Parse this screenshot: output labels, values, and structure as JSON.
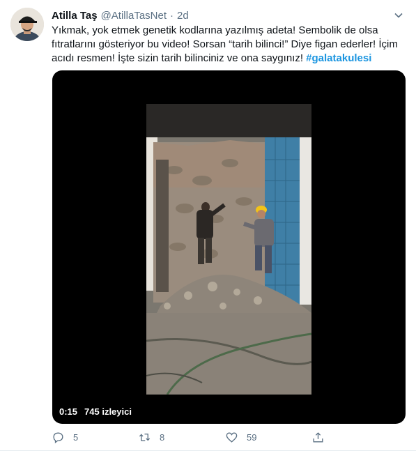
{
  "tweet": {
    "author_name": "Atilla Taş",
    "handle": "@AtillaTasNet",
    "separator": "·",
    "time": "2d",
    "text": "Yıkmak, yok etmek genetik kodlarına yazılmış adeta! Sembolik de olsa fıtratlarını gösteriyor bu video! Sorsan “tarih bilinci!” Diye figan ederler! İçim acıdı resmen! İşte sizin tarih bilinciniz ve ona saygınız!",
    "hashtag": "#galatakulesi"
  },
  "video": {
    "duration": "0:15",
    "views": "745 izleyici"
  },
  "actions": {
    "replies": "5",
    "retweets": "8",
    "likes": "59"
  },
  "colors": {
    "link": "#1b95e0",
    "secondary_text": "#5b7083",
    "media_bg": "#000000"
  }
}
